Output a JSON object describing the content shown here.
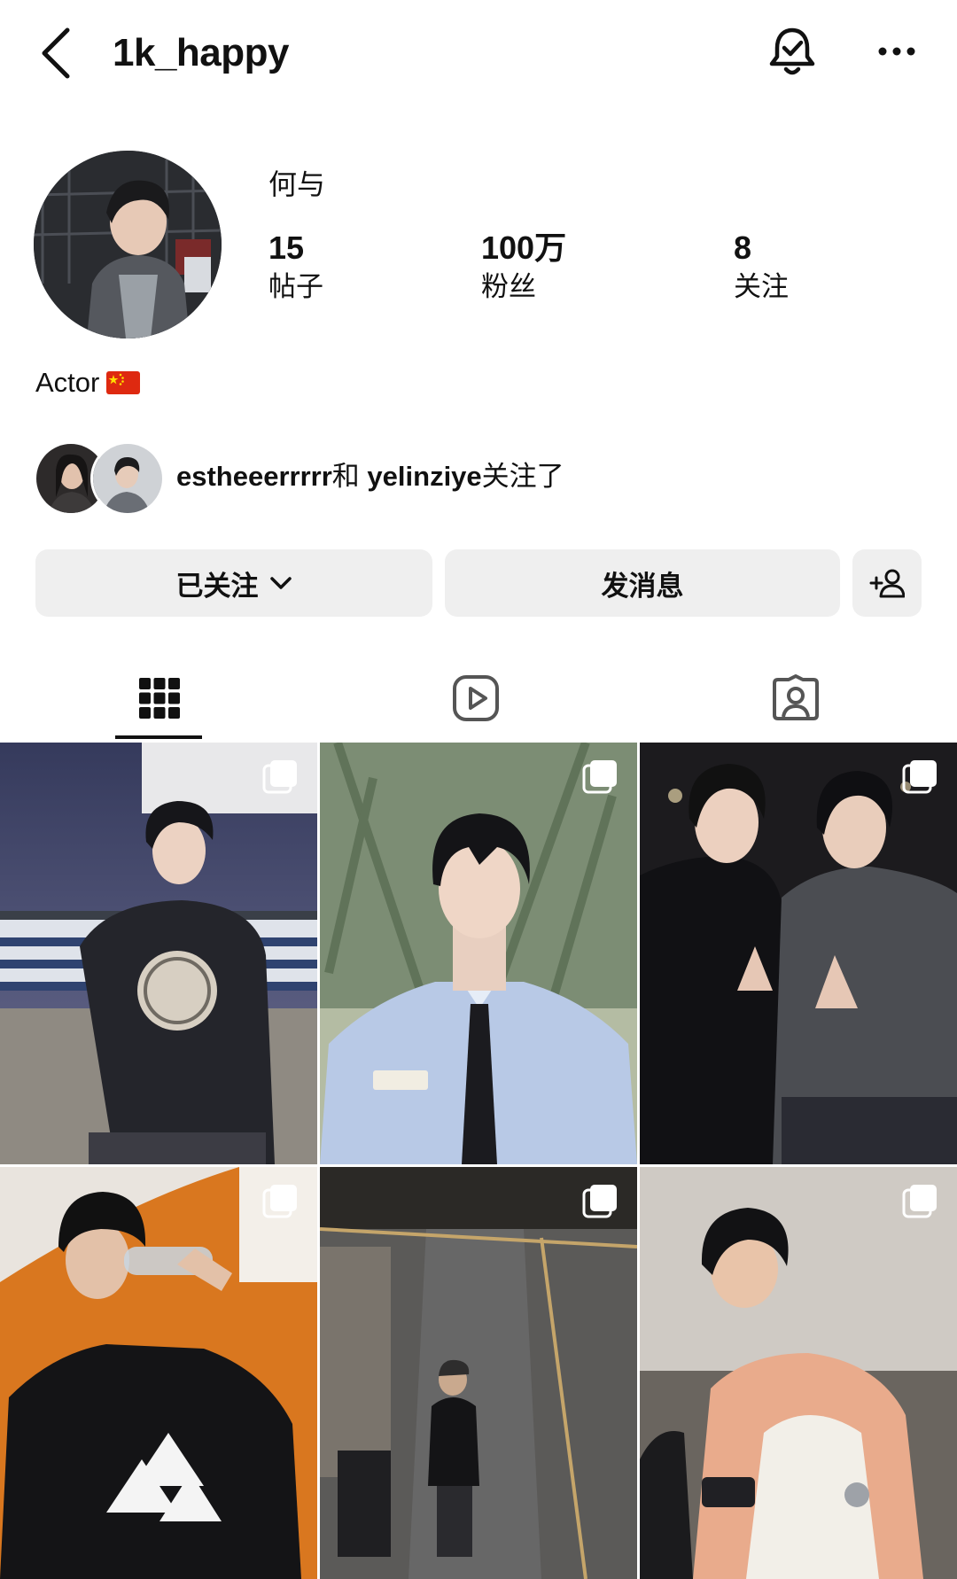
{
  "header": {
    "username": "1k_happy",
    "icons": [
      "back-chevron-icon",
      "notification-bell-icon",
      "more-options-icon"
    ]
  },
  "profile": {
    "display_name": "何与",
    "stats": [
      {
        "value": "15",
        "label": "帖子"
      },
      {
        "value": "100万",
        "label": "粉丝"
      },
      {
        "value": "8",
        "label": "关注"
      }
    ],
    "bio": "Actor",
    "bio_flag": "china-flag-icon",
    "followed_by": {
      "user1": "estheeerrrrr",
      "connector": "和",
      "user2": "yelinziye",
      "suffix": "关注了"
    }
  },
  "actions": {
    "following_label": "已关注",
    "message_label": "发消息",
    "add_person_icon": "add-person-icon"
  },
  "tabs": [
    {
      "icon": "grid-icon",
      "active": true
    },
    {
      "icon": "reels-icon",
      "active": false
    },
    {
      "icon": "tagged-icon",
      "active": false
    }
  ],
  "posts": [
    {
      "id": 1,
      "multi": true
    },
    {
      "id": 2,
      "multi": true
    },
    {
      "id": 3,
      "multi": true
    },
    {
      "id": 4,
      "multi": true
    },
    {
      "id": 5,
      "multi": true
    },
    {
      "id": 6,
      "multi": true
    }
  ],
  "colors": {
    "button_bg": "#efefef",
    "text": "#111111",
    "icon_gray": "#555555"
  }
}
